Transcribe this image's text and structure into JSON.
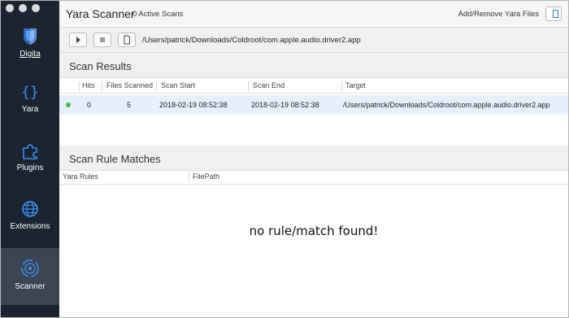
{
  "sidebar": {
    "items": [
      {
        "label": "Digita",
        "icon": "digita-logo-icon"
      },
      {
        "label": "Yara",
        "icon": "curly-braces-icon"
      },
      {
        "label": "Plugins",
        "icon": "puzzle-icon"
      },
      {
        "label": "Extensions",
        "icon": "globe-icon"
      },
      {
        "label": "Scanner",
        "icon": "scanner-icon",
        "active": true
      }
    ]
  },
  "header": {
    "title": "Yara Scanner",
    "active_scans": "0 Active Scans",
    "add_remove_label": "Add/Remove Yara Files"
  },
  "toolbar": {
    "path": "/Users/patrick/Downloads/Coldroot/com.apple.audio.driver2.app"
  },
  "scan_results": {
    "title": "Scan Results",
    "columns": [
      "Hits",
      "Files Scanned",
      "Scan Start",
      "Scan End",
      "Target"
    ],
    "rows": [
      {
        "status": "active",
        "hits": "0",
        "files_scanned": "5",
        "scan_start": "2018-02-19 08:52:38",
        "scan_end": "2018-02-19 08:52:38",
        "target": "/Users/patrick/Downloads/Coldroot/com.apple.audio.driver2.app"
      }
    ]
  },
  "rule_matches": {
    "title": "Scan Rule Matches",
    "columns": [
      "Yara Rules",
      "FilePath"
    ],
    "empty_message": "no rule/match found!"
  },
  "colors": {
    "sidebar_bg": "#1b2430",
    "sidebar_active": "#3a4453",
    "accent": "#2b7be4",
    "selected_row": "#e6effb",
    "status_green": "#3fbf3f"
  }
}
